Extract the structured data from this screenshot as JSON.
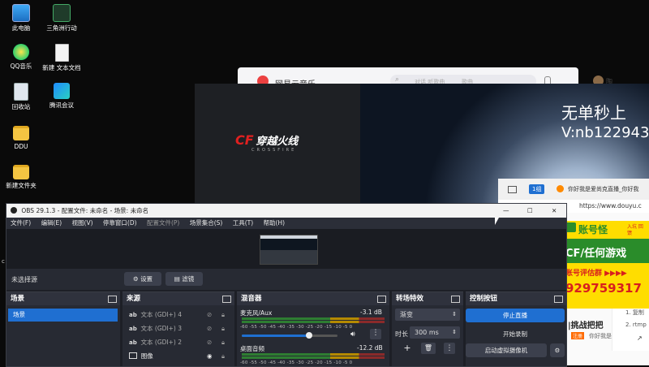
{
  "desktop": {
    "icons": [
      {
        "label": "此电脑"
      },
      {
        "label": "三角洲行动"
      },
      {
        "label": "QQ音乐"
      },
      {
        "label": "新建 文本文档"
      },
      {
        "label": "回收站"
      },
      {
        "label": "腾讯会议"
      },
      {
        "label": "DDU"
      },
      {
        "label": "新建文件夹"
      }
    ]
  },
  "netease": {
    "title": "网易云音乐",
    "search_placeholder": "对话 听歌曲",
    "search_hint": "歌曲",
    "user": "陶博"
  },
  "cf_window": {
    "logo_text": "穿越火线",
    "logo_sub": "CROSSFIRE",
    "overlay_line1": "无单秒上",
    "overlay_line2": "V:nb122943"
  },
  "browser": {
    "tab_count": "1组",
    "tab_title": "你好我是爱尚克直播_你好我",
    "url": "https://www.douyu.c",
    "side_item1": "1. 复制",
    "side_item2": "2. rtmp",
    "partial_title": "|挑战把把",
    "partial_tag": "注册",
    "partial_text": "你好我是"
  },
  "ad": {
    "line1": "账号怪",
    "corner": "入坑 回馈",
    "line2": "CF/任何游戏",
    "line3": "账号评估群 ▶▶▶▶",
    "line4": "929759317"
  },
  "obs": {
    "title": "OBS 29.1.3 - 配置文件: 未命名 - 场景: 未命名",
    "menu": [
      "文件(F)",
      "编辑(E)",
      "视图(V)",
      "停靠窗口(D)",
      "配置文件(P)",
      "场景集合(S)",
      "工具(T)",
      "帮助(H)"
    ],
    "no_source": "未选择源",
    "settings_btn": "设置",
    "filters_btn": "滤镜",
    "scenes": {
      "title": "场景",
      "items": [
        "场景"
      ]
    },
    "sources": {
      "title": "来源",
      "items": [
        "文本 (GDI+) 4",
        "文本 (GDI+) 3",
        "文本 (GDI+) 2",
        "图像"
      ]
    },
    "mixer": {
      "title": "混音器",
      "ticks": "-60 -55 -50 -45 -40 -35 -30 -25 -20 -15 -10 -5 0",
      "channels": [
        {
          "name": "麦克风/Aux",
          "db": "-3.1 dB",
          "volume": 0.7
        },
        {
          "name": "桌面音频",
          "db": "-12.2 dB",
          "volume": 0.7
        }
      ]
    },
    "transitions": {
      "title": "转场特效",
      "type": "渐变",
      "duration_label": "时长",
      "duration": "300 ms"
    },
    "controls": {
      "title": "控制按钮",
      "stop_stream": "停止直播",
      "start_record": "开始录制",
      "virtual_cam": "启动虚拟摄像机"
    },
    "window_buttons": {
      "minimize": "—",
      "maximize": "☐",
      "close": "✕"
    }
  },
  "colors": {
    "obs_accent": "#1f6fd1",
    "ad_bg": "#ffdd00",
    "ad_green": "#2a8c2a",
    "ad_red": "#d81e1e"
  }
}
